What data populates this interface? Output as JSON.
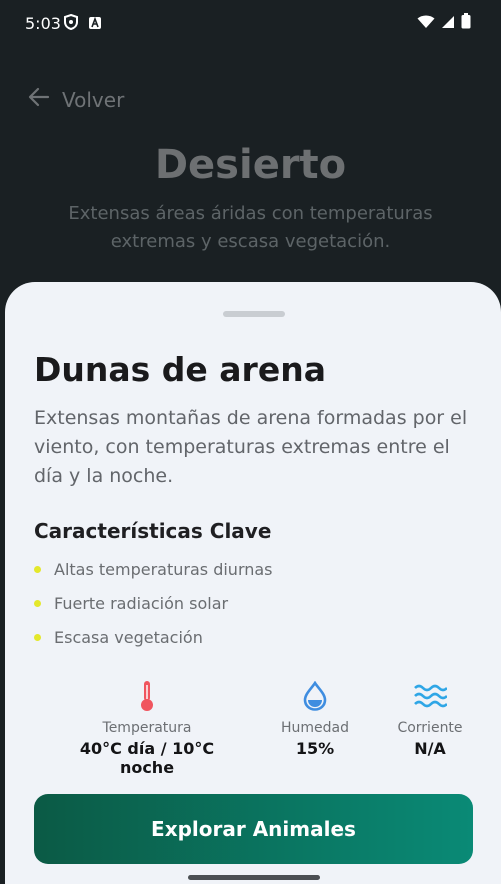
{
  "status_bar": {
    "time": "5:03",
    "left_icons": [
      "shield-icon",
      "notification-app-icon"
    ],
    "right_icons": [
      "wifi-icon",
      "signal-icon",
      "battery-icon"
    ]
  },
  "hero": {
    "back_label": "Volver",
    "title": "Desierto",
    "description": "Extensas áreas áridas con temperaturas extremas y escasa vegetación."
  },
  "sheet": {
    "title": "Dunas de arena",
    "description": "Extensas montañas de arena formadas por el viento, con temperaturas extremas entre el día y la noche.",
    "features_title": "Características Clave",
    "features": [
      "Altas temperaturas diurnas",
      "Fuerte radiación solar",
      "Escasa vegetación"
    ],
    "stats": {
      "temperature": {
        "label": "Temperatura",
        "value": "40°C día / 10°C noche",
        "icon": "thermometer-icon",
        "color": "#f0555f"
      },
      "humidity": {
        "label": "Humedad",
        "value": "15%",
        "icon": "water-drop-icon",
        "color": "#3f8de0"
      },
      "current": {
        "label": "Corriente",
        "value": "N/A",
        "icon": "waves-icon",
        "color": "#2fa6e6"
      }
    },
    "button_label": "Explorar Animales"
  },
  "colors": {
    "accent_start": "#0b5a45",
    "accent_end": "#0a8a76",
    "bullet": "#e4e82b",
    "sheet_bg": "#f0f3f8"
  }
}
